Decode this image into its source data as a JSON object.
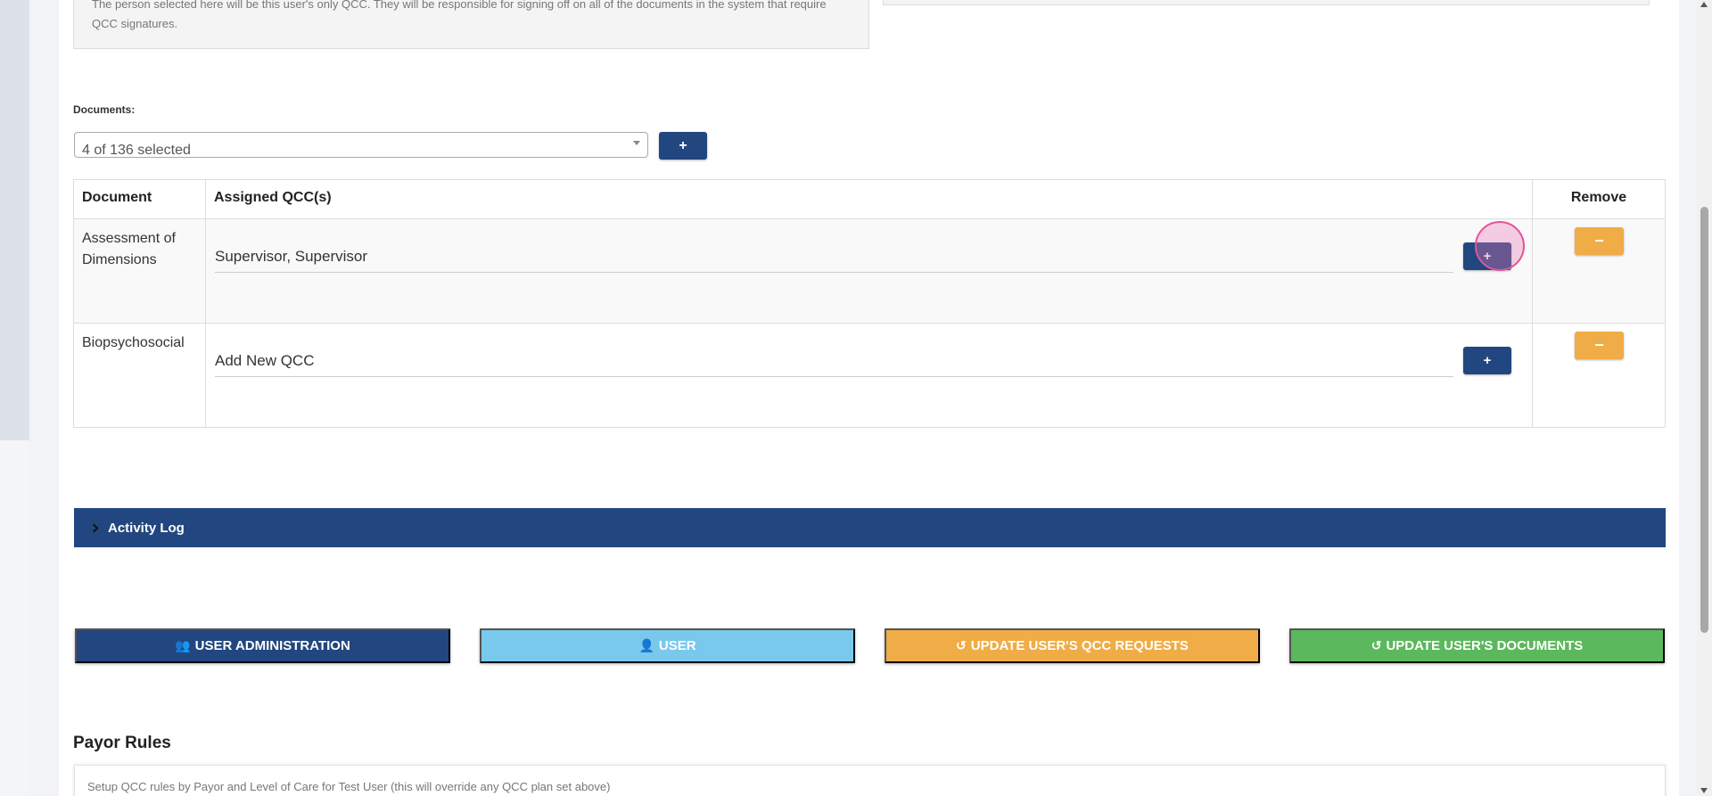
{
  "qcc_note": {
    "text": "The person selected here will be this user's only QCC. They will be responsible for signing off on all of the documents in the system that require QCC signatures."
  },
  "documents": {
    "label": "Documents:",
    "selected_value": "4 of 136 selected",
    "add_icon": "plus-icon",
    "add_glyph": "+"
  },
  "qcc_table": {
    "headers": {
      "document": "Document",
      "assigned": "Assigned QCC(s)",
      "remove": "Remove"
    },
    "rows": [
      {
        "document": "Assessment of Dimensions",
        "assigned": "Supervisor, Supervisor",
        "add_glyph": "+",
        "remove_glyph": "−"
      },
      {
        "document": "Biopsychosocial",
        "assigned": "Add New QCC",
        "add_glyph": "+",
        "remove_glyph": "−"
      }
    ]
  },
  "activity_log": {
    "label": "Activity Log"
  },
  "actions": {
    "user_admin": {
      "label": "USER ADMINISTRATION",
      "icon": "users-icon",
      "glyph": "👥"
    },
    "user": {
      "label": "USER",
      "icon": "user-icon",
      "glyph": "👤"
    },
    "update_qcc": {
      "label": "UPDATE USER'S QCC REQUESTS",
      "icon": "refresh-icon",
      "glyph": "↺"
    },
    "update_docs": {
      "label": "UPDATE USER'S DOCUMENTS",
      "icon": "refresh-icon",
      "glyph": "↺"
    }
  },
  "payor_rules": {
    "title": "Payor Rules",
    "description": "Setup QCC rules by Payor and Level of Care for Test User (this will override any QCC plan set above)"
  },
  "colors": {
    "primary": "#22467f",
    "info": "#78c9ec",
    "warning": "#f0ac46",
    "success": "#5cb85c"
  }
}
